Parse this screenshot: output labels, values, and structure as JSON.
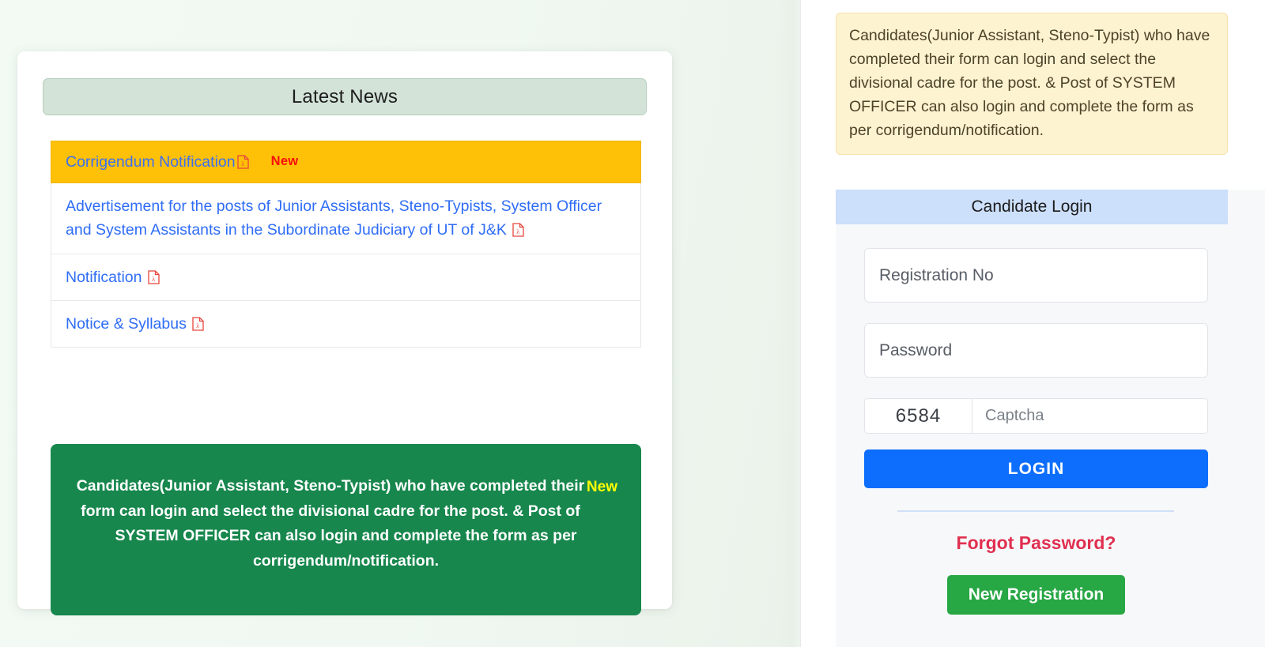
{
  "news_panel": {
    "header_title": "Latest News",
    "items": [
      {
        "label": "Corrigendum Notification",
        "icon": "pdf-icon",
        "badge": "New",
        "highlighted": true
      },
      {
        "label": "Advertisement for the posts of Junior Assistants, Steno-Typists, System Officer and System Assistants in the Subordinate Judiciary of UT of J&K",
        "icon": "pdf-icon",
        "badge": "",
        "highlighted": false
      },
      {
        "label": "Notification",
        "icon": "pdf-icon",
        "badge": "",
        "highlighted": false
      },
      {
        "label": "Notice & Syllabus",
        "icon": "pdf-icon",
        "badge": "",
        "highlighted": false
      }
    ],
    "green_notice": {
      "text": "Candidates(Junior Assistant, Steno-Typist) who have completed their form can login and select the divisional cadre for the post. & Post of SYSTEM OFFICER can also login and complete the form as per corrigendum/notification.",
      "badge": "New"
    }
  },
  "side_panel": {
    "notice_text": "Candidates(Junior Assistant, Steno-Typist) who have completed their form can login and select the divisional cadre for the post. & Post of SYSTEM OFFICER can also login and complete the form as per corrigendum/notification.",
    "login": {
      "title": "Candidate Login",
      "registration_placeholder": "Registration No",
      "registration_value": "",
      "password_placeholder": "Password",
      "password_value": "",
      "captcha_code": "6584",
      "captcha_placeholder": "Captcha",
      "captcha_value": "",
      "login_button": "LOGIN",
      "forgot_password": "Forgot Password?",
      "new_registration": "New Registration"
    }
  },
  "colors": {
    "page_left_background": "#f1f8f2",
    "news_header_background": "#d3e3d8",
    "highlight_row_background": "#ffc107",
    "link_blue": "#2f6df6",
    "badge_red": "#f60d0d",
    "green_notice_background": "#17874d",
    "green_notice_badge": "#ffff00",
    "yellow_note_background": "#fdf3d1",
    "login_title_background": "#ccdffb",
    "login_button_background": "#0d6efd",
    "forgot_password_color": "#e03050",
    "new_registration_background": "#28a745",
    "pdf_icon_color": "#e8453c"
  }
}
